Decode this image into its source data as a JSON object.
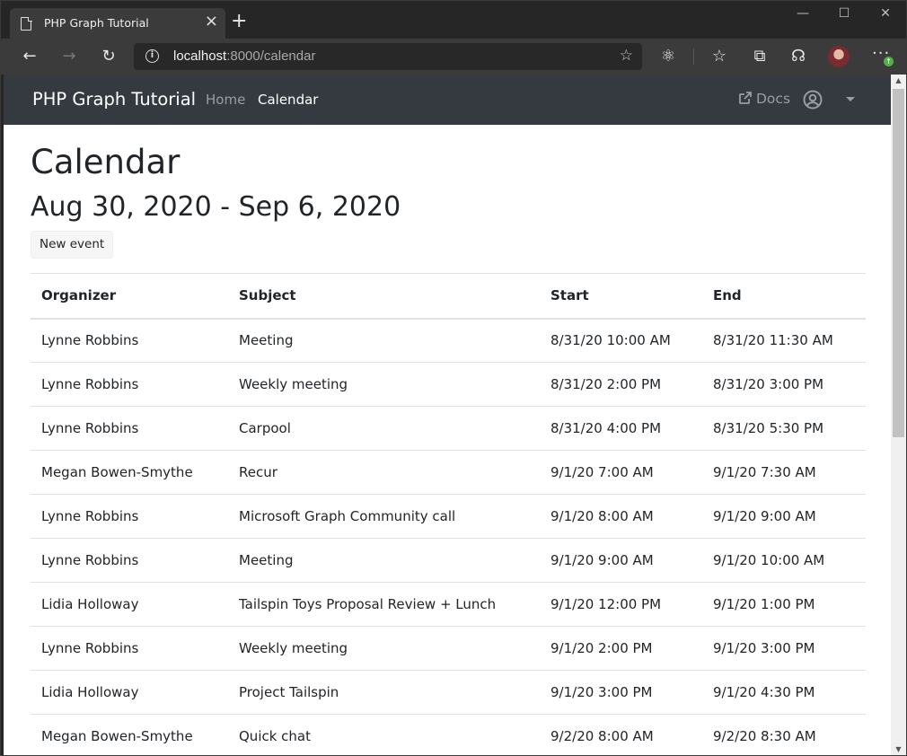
{
  "browser": {
    "tab_title": "PHP Graph Tutorial",
    "url_host": "localhost",
    "url_rest": ":8000/calendar"
  },
  "navbar": {
    "brand": "PHP Graph Tutorial",
    "links": [
      {
        "label": "Home",
        "active": false
      },
      {
        "label": "Calendar",
        "active": true
      }
    ],
    "docs_label": "Docs"
  },
  "page": {
    "title": "Calendar",
    "date_range": "Aug 30, 2020 - Sep 6, 2020",
    "new_event_label": "New event"
  },
  "table": {
    "headers": [
      "Organizer",
      "Subject",
      "Start",
      "End"
    ],
    "rows": [
      [
        "Lynne Robbins",
        "Meeting",
        "8/31/20 10:00 AM",
        "8/31/20 11:30 AM"
      ],
      [
        "Lynne Robbins",
        "Weekly meeting",
        "8/31/20 2:00 PM",
        "8/31/20 3:00 PM"
      ],
      [
        "Lynne Robbins",
        "Carpool",
        "8/31/20 4:00 PM",
        "8/31/20 5:30 PM"
      ],
      [
        "Megan Bowen-Smythe",
        "Recur",
        "9/1/20 7:00 AM",
        "9/1/20 7:30 AM"
      ],
      [
        "Lynne Robbins",
        "Microsoft Graph Community call",
        "9/1/20 8:00 AM",
        "9/1/20 9:00 AM"
      ],
      [
        "Lynne Robbins",
        "Meeting",
        "9/1/20 9:00 AM",
        "9/1/20 10:00 AM"
      ],
      [
        "Lidia Holloway",
        "Tailspin Toys Proposal Review + Lunch",
        "9/1/20 12:00 PM",
        "9/1/20 1:00 PM"
      ],
      [
        "Lynne Robbins",
        "Weekly meeting",
        "9/1/20 2:00 PM",
        "9/1/20 3:00 PM"
      ],
      [
        "Lidia Holloway",
        "Project Tailspin",
        "9/1/20 3:00 PM",
        "9/1/20 4:30 PM"
      ],
      [
        "Megan Bowen-Smythe",
        "Quick chat",
        "9/2/20 8:00 AM",
        "9/2/20 8:30 AM"
      ]
    ]
  },
  "colors": {
    "navbar_bg": "#343a40",
    "browser_chrome": "#3b3b3b",
    "text": "#212529"
  }
}
